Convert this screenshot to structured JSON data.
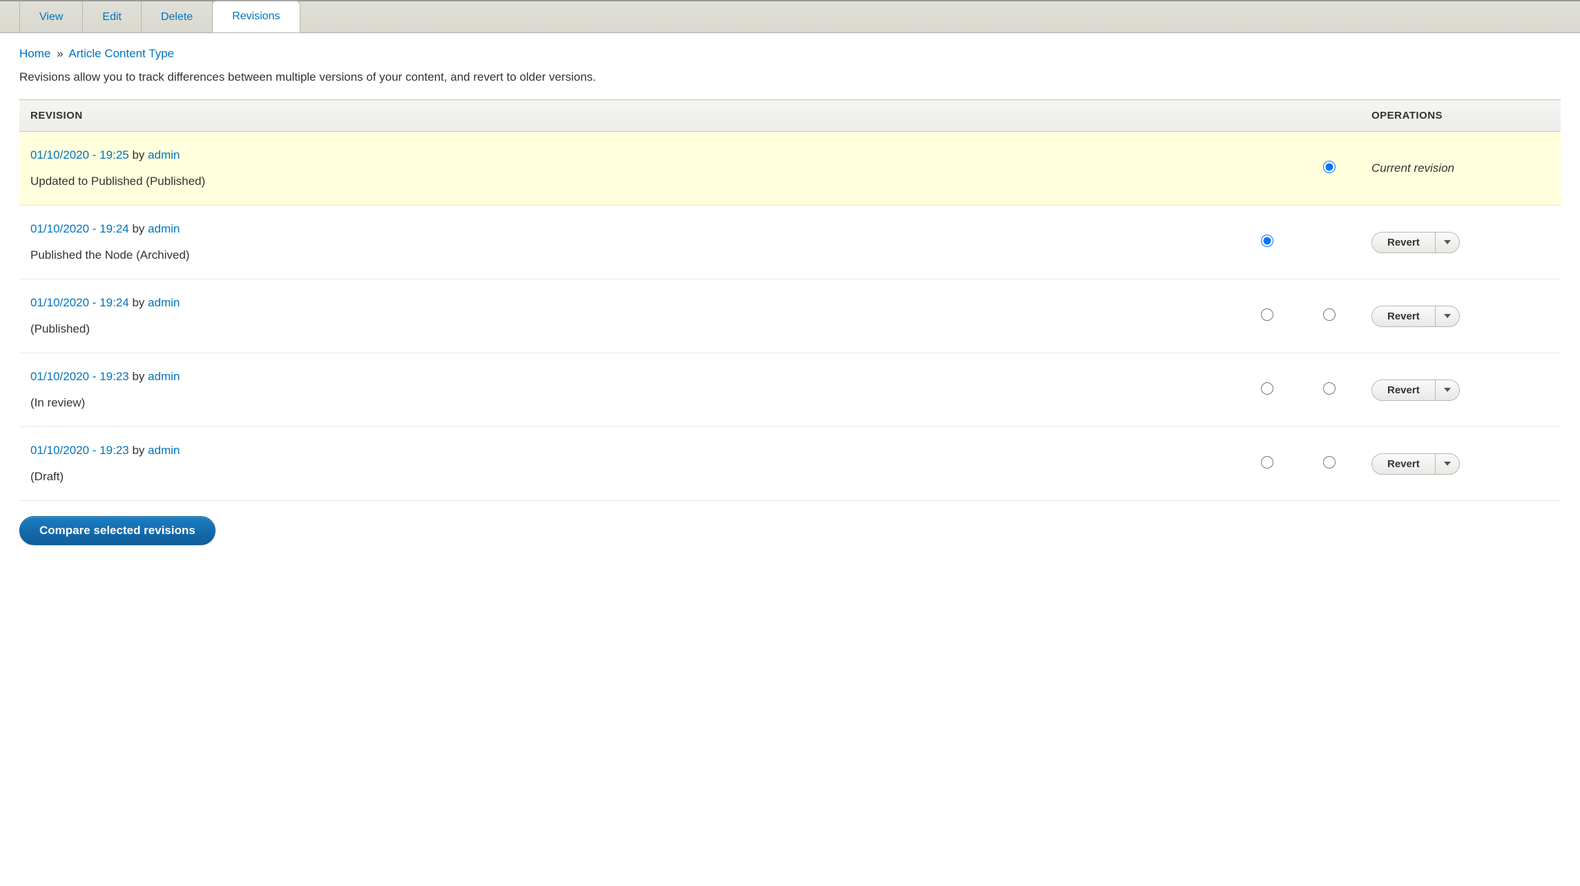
{
  "tabs": [
    {
      "label": "View"
    },
    {
      "label": "Edit"
    },
    {
      "label": "Delete"
    },
    {
      "label": "Revisions"
    }
  ],
  "breadcrumb": {
    "home": "Home",
    "sep": "»",
    "title": "Article Content Type"
  },
  "description": "Revisions allow you to track differences between multiple versions of your content, and revert to older versions.",
  "table": {
    "headers": {
      "revision": "REVISION",
      "operations": "OPERATIONS"
    },
    "by_word": "by",
    "revert_label": "Revert",
    "current_label": "Current revision"
  },
  "revisions": [
    {
      "datetime": "01/10/2020 - 19:25",
      "author": "admin",
      "note": "Updated to Published (Published)",
      "current": true
    },
    {
      "datetime": "01/10/2020 - 19:24",
      "author": "admin",
      "note": "Published the Node (Archived)",
      "current": false
    },
    {
      "datetime": "01/10/2020 - 19:24",
      "author": "admin",
      "note": "(Published)",
      "current": false
    },
    {
      "datetime": "01/10/2020 - 19:23",
      "author": "admin",
      "note": "(In review)",
      "current": false
    },
    {
      "datetime": "01/10/2020 - 19:23",
      "author": "admin",
      "note": "(Draft)",
      "current": false
    }
  ],
  "compare_label": "Compare selected revisions"
}
